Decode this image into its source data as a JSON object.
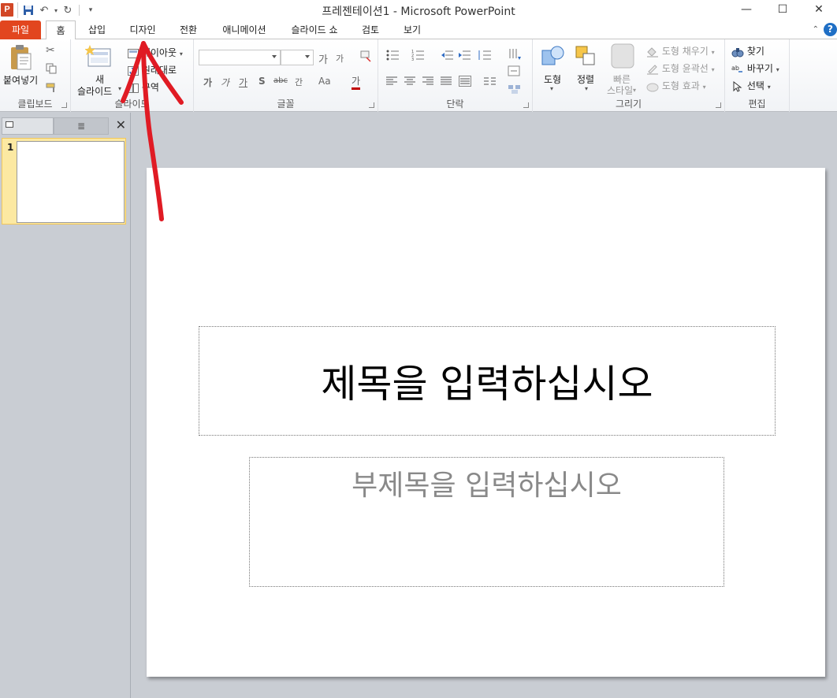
{
  "window": {
    "title": "프레젠테이션1  -  Microsoft PowerPoint",
    "app_icon": "P"
  },
  "tabs": [
    {
      "label": "파일"
    },
    {
      "label": "홈"
    },
    {
      "label": "삽입"
    },
    {
      "label": "디자인"
    },
    {
      "label": "전환"
    },
    {
      "label": "애니메이션"
    },
    {
      "label": "슬라이드 쇼"
    },
    {
      "label": "검토"
    },
    {
      "label": "보기"
    }
  ],
  "ribbon": {
    "clipboard": {
      "paste": "붙여넣기",
      "label": "클립보드"
    },
    "slides": {
      "new_line1": "새",
      "new_line2": "슬라이드",
      "layout": "레이아웃",
      "reset": "원래대로",
      "section": "구역",
      "label": "슬라이드"
    },
    "font": {
      "label": "글꼴",
      "grow": "가",
      "shrink": "가",
      "bold": "가",
      "italic": "가",
      "underline": "가",
      "shadow": "S",
      "strike": "abc",
      "spacing": "간",
      "case": "Aa",
      "color": "가"
    },
    "paragraph": {
      "label": "단락"
    },
    "drawing": {
      "shapes": "도형",
      "arrange": "정렬",
      "quick_line1": "빠른",
      "quick_line2": "스타일",
      "fill": "도형 채우기",
      "outline": "도형 윤곽선",
      "effects": "도형 효과",
      "label": "그리기"
    },
    "editing": {
      "find": "찾기",
      "replace": "바꾸기",
      "select": "선택",
      "label": "편집"
    }
  },
  "slides_pane": {
    "thumb_number": "1"
  },
  "slide": {
    "title_placeholder": "제목을 입력하십시오",
    "subtitle_placeholder": "부제목을 입력하십시오"
  },
  "colors": {
    "file_tab": "#e2461f",
    "annotation": "#e01b24",
    "selection": "#fce9a2"
  }
}
